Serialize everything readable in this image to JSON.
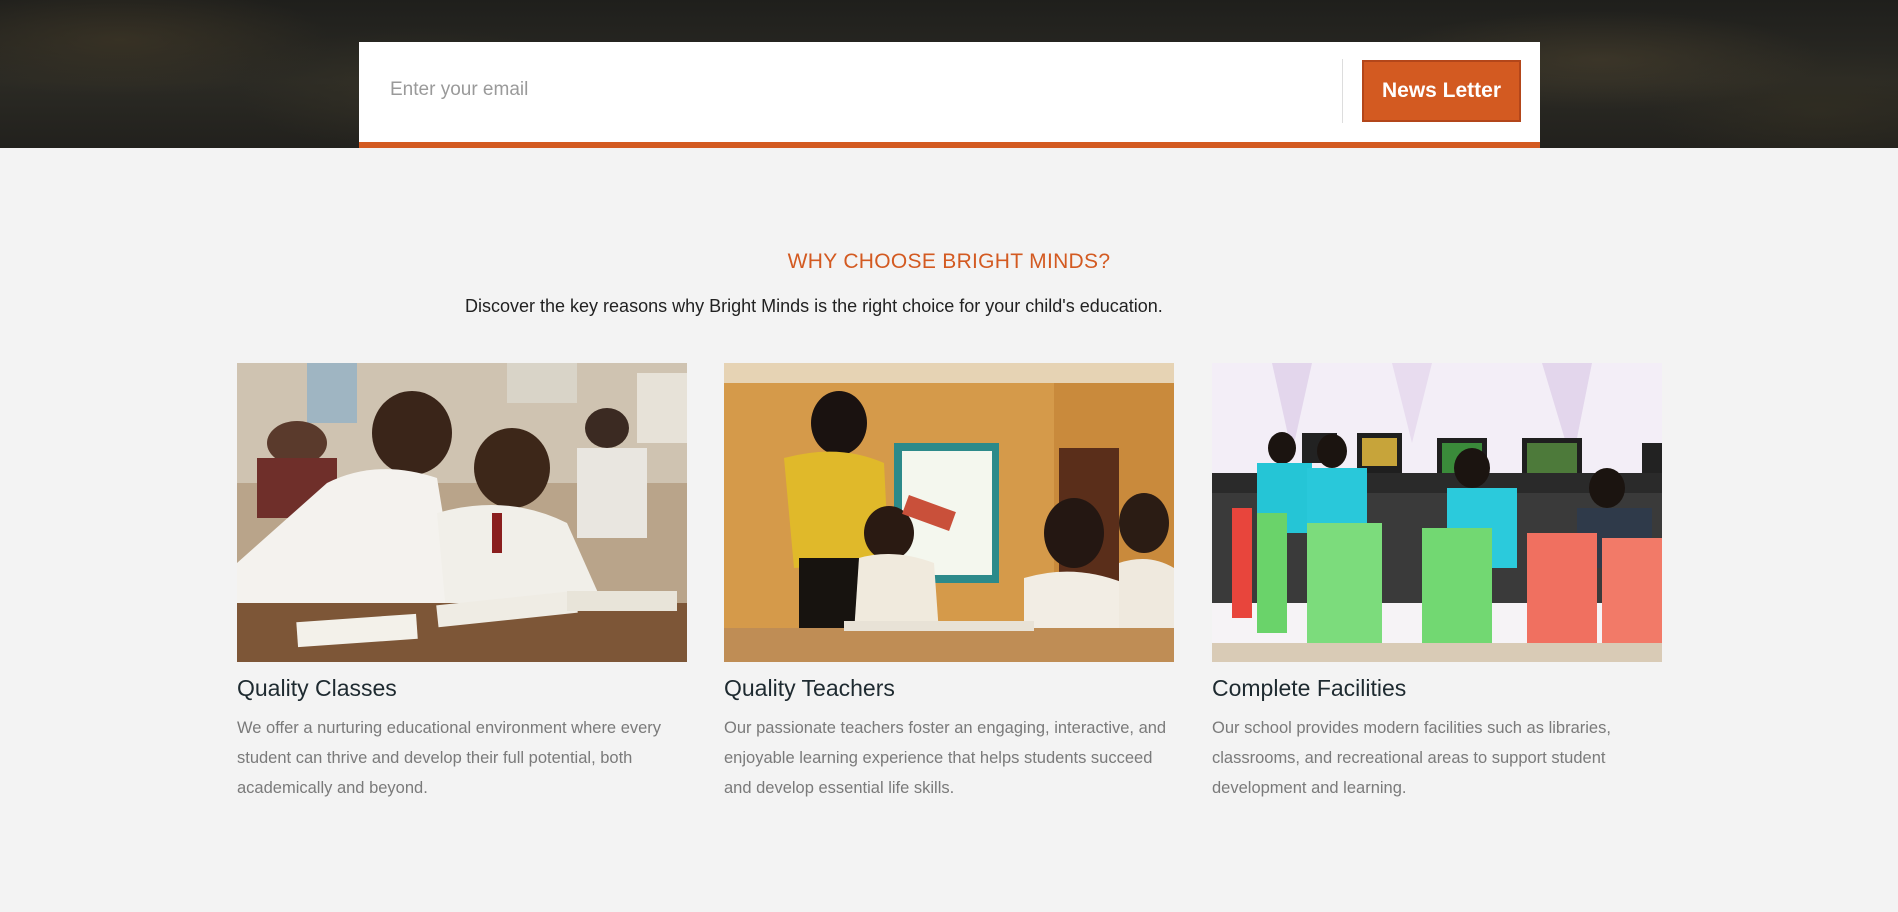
{
  "newsletter": {
    "email_placeholder": "Enter your email",
    "email_value": "",
    "button_label": "News Letter"
  },
  "section": {
    "title": "WHY CHOOSE BRIGHT MINDS?",
    "subtitle": "Discover the key reasons why Bright Minds is the right choice for your child's education."
  },
  "cards": [
    {
      "title": "Quality Classes",
      "text": "We offer a nurturing educational environment where every student can thrive and develop their full potential, both academically and beyond."
    },
    {
      "title": "Quality Teachers",
      "text": "Our passionate teachers foster an engaging, interactive, and enjoyable learning experience that helps students succeed and develop essential life skills."
    },
    {
      "title": "Complete Facilities",
      "text": "Our school provides modern facilities such as libraries, classrooms, and recreational areas to support student development and learning."
    }
  ],
  "colors": {
    "accent": "#d35a21",
    "background": "#f3f3f3",
    "heading": "#1e2a30",
    "body_text": "#7a7a7a"
  }
}
